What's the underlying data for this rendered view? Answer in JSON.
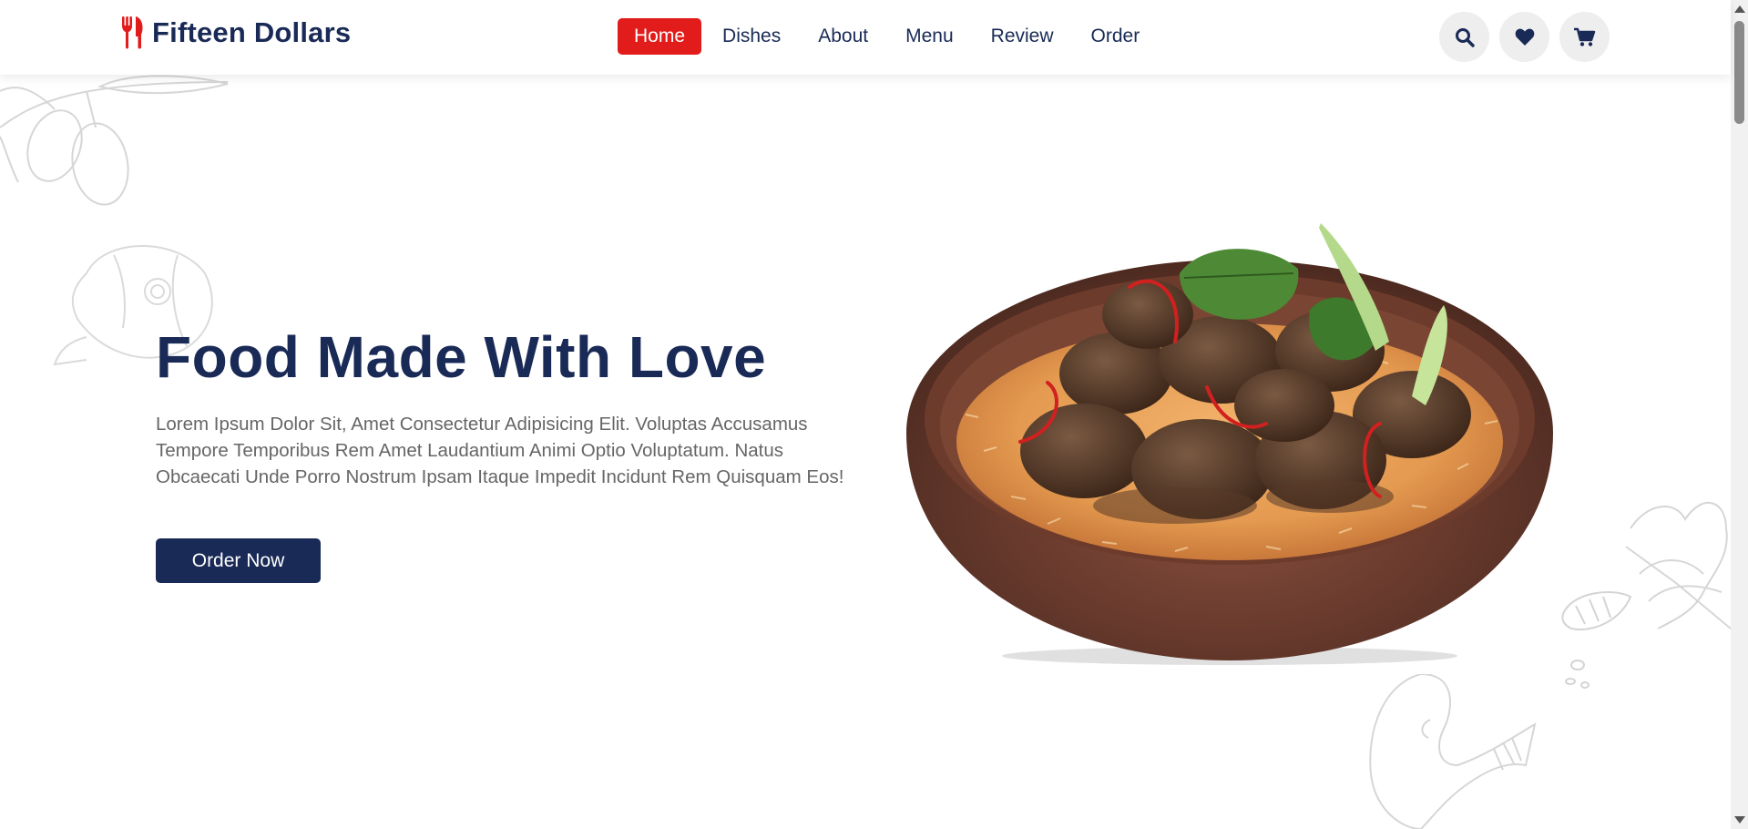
{
  "brand": {
    "name": "Fifteen Dollars",
    "icon": "utensils-icon",
    "accent_color": "#e21b1b",
    "primary_color": "#192a56"
  },
  "nav": {
    "items": [
      {
        "label": "Home",
        "active": true
      },
      {
        "label": "Dishes",
        "active": false
      },
      {
        "label": "About",
        "active": false
      },
      {
        "label": "Menu",
        "active": false
      },
      {
        "label": "Review",
        "active": false
      },
      {
        "label": "Order",
        "active": false
      }
    ]
  },
  "header_icons": [
    "search-icon",
    "heart-icon",
    "cart-icon"
  ],
  "hero": {
    "title": "Food Made With Love",
    "text": "Lorem Ipsum Dolor Sit, Amet Consectetur Adipisicing Elit. Voluptas Accusamus Tempore Temporibus Rem Amet Laudantium Animi Optio Voluptatum. Natus Obcaecati Unde Porro Nostrum Ipsam Itaque Impedit Incidunt Rem Quisquam Eos!",
    "button_label": "Order Now",
    "image": "rice-and-beef-curry-dish"
  }
}
